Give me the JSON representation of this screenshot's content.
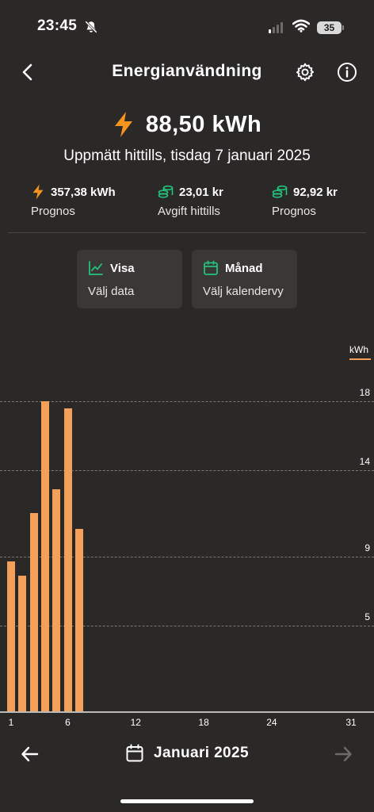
{
  "status_bar": {
    "time": "23:45",
    "battery": "35"
  },
  "header": {
    "title": "Energianvändning"
  },
  "summary": {
    "main_value": "88,50 kWh",
    "measured_text": "Uppmätt hittills, tisdag 7 januari 2025",
    "stats": [
      {
        "value": "357,38 kWh",
        "label": "Prognos",
        "icon": "bolt-icon"
      },
      {
        "value": "23,01 kr",
        "label": "Avgift hittills",
        "icon": "coins-icon"
      },
      {
        "value": "92,92 kr",
        "label": "Prognos",
        "icon": "coins-icon"
      }
    ]
  },
  "cards": {
    "data": {
      "title": "Visa",
      "subtitle": "Välj data",
      "icon": "line-chart-icon"
    },
    "calendar": {
      "title": "Månad",
      "subtitle": "Välj kalendervy",
      "icon": "calendar-icon"
    }
  },
  "chart_data": {
    "type": "bar",
    "unit": "kWh",
    "y_ticks": [
      "5",
      "9",
      "14",
      "18"
    ],
    "x_ticks": [
      "1",
      "6",
      "12",
      "18",
      "24",
      "31"
    ],
    "x_range": [
      1,
      31
    ],
    "ylim": [
      0,
      18.3
    ],
    "categories": [
      "1",
      "2",
      "3",
      "4",
      "5",
      "6",
      "7",
      "8",
      "9",
      "10",
      "11",
      "12",
      "13",
      "14",
      "15",
      "16",
      "17",
      "18",
      "19",
      "20",
      "21",
      "22",
      "23",
      "24",
      "25",
      "26",
      "27",
      "28",
      "29",
      "30",
      "31"
    ],
    "values": [
      8.7,
      7.9,
      11.5,
      18.0,
      12.9,
      17.6,
      10.6
    ],
    "color": "#f5a05a",
    "grid": true
  },
  "footer": {
    "month_label": "Januari 2025"
  },
  "colors": {
    "accent_orange": "#f7941d",
    "accent_green": "#22c27a",
    "bar": "#f5a05a",
    "background": "#2b2928"
  }
}
